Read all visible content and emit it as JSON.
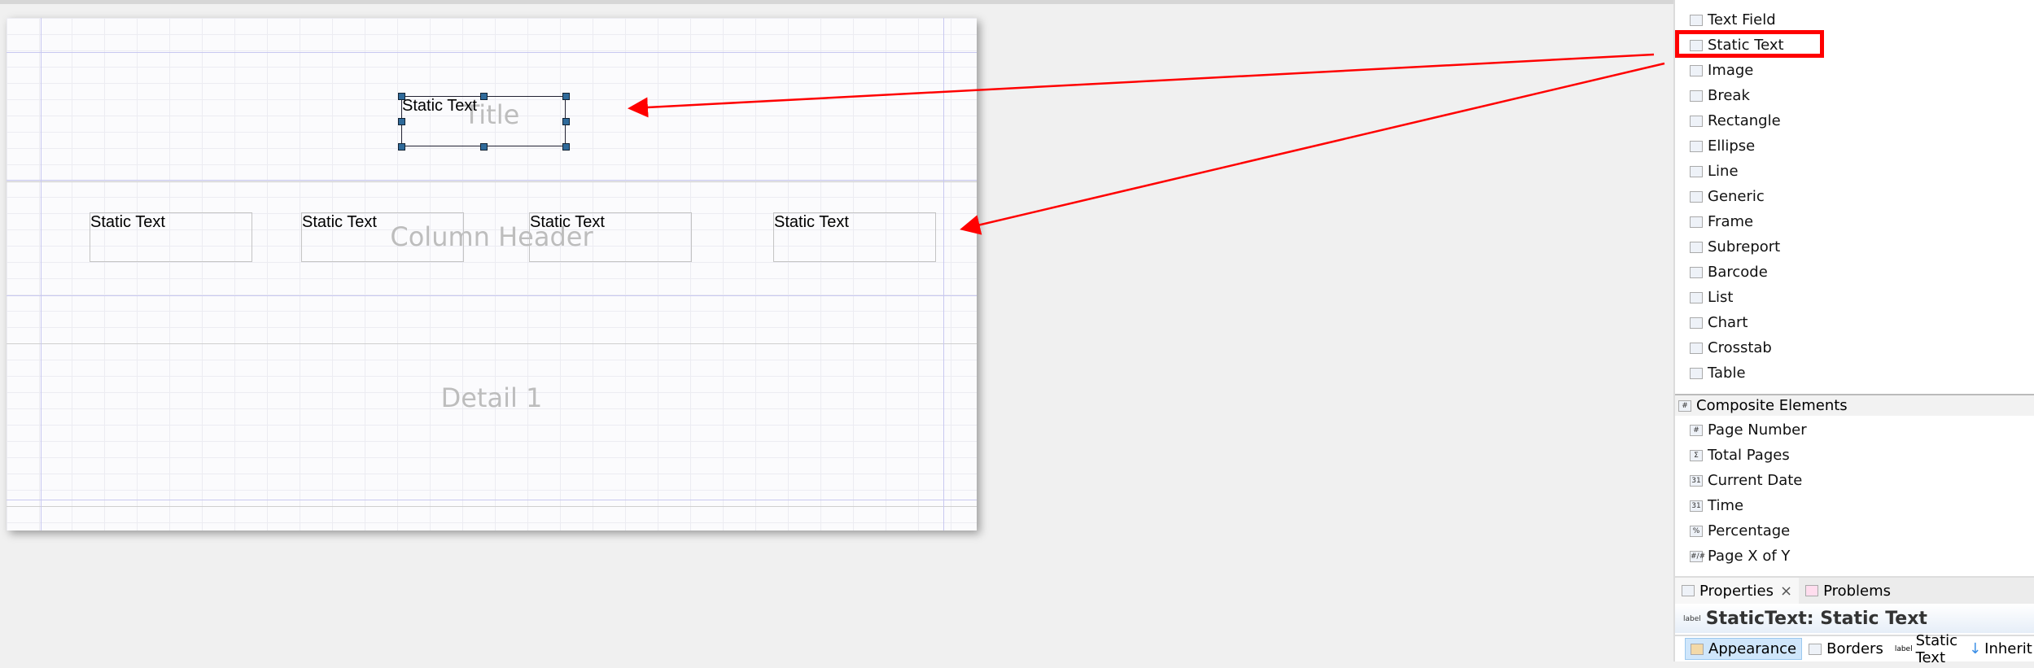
{
  "canvas": {
    "bands": {
      "title": "Title",
      "column_header": "Column Header",
      "detail": "Detail 1"
    },
    "title_element": "Static Text",
    "column_elements": [
      "Static Text",
      "Static Text",
      "Static Text",
      "Static Text"
    ]
  },
  "palette": {
    "basic_items": [
      {
        "label": "Text Field",
        "icon": "text-field-icon"
      },
      {
        "label": "Static Text",
        "icon": "label-icon",
        "highlighted": true
      },
      {
        "label": "Image",
        "icon": "image-icon"
      },
      {
        "label": "Break",
        "icon": "break-icon"
      },
      {
        "label": "Rectangle",
        "icon": "rectangle-icon"
      },
      {
        "label": "Ellipse",
        "icon": "ellipse-icon"
      },
      {
        "label": "Line",
        "icon": "line-icon"
      },
      {
        "label": "Generic",
        "icon": "generic-icon"
      },
      {
        "label": "Frame",
        "icon": "frame-icon"
      },
      {
        "label": "Subreport",
        "icon": "subreport-icon"
      },
      {
        "label": "Barcode",
        "icon": "barcode-icon"
      },
      {
        "label": "List",
        "icon": "list-icon"
      },
      {
        "label": "Chart",
        "icon": "chart-icon"
      },
      {
        "label": "Crosstab",
        "icon": "crosstab-icon"
      },
      {
        "label": "Table",
        "icon": "table-icon"
      }
    ],
    "composite_header": "Composite Elements",
    "composite_items": [
      {
        "label": "Page Number",
        "glyph": "#"
      },
      {
        "label": "Total Pages",
        "glyph": "Σ"
      },
      {
        "label": "Current Date",
        "glyph": "31"
      },
      {
        "label": "Time",
        "glyph": "31"
      },
      {
        "label": "Percentage",
        "glyph": "%"
      },
      {
        "label": "Page X of Y",
        "glyph": "#/#"
      }
    ]
  },
  "properties": {
    "tabs": [
      "Properties",
      "Problems"
    ],
    "close": "×",
    "title": "StaticText: Static Text",
    "subtabs": [
      "Appearance",
      "Borders",
      "Static Text",
      "Inherit"
    ]
  },
  "colors": {
    "highlight": "#ff0000",
    "arrow": "#ff0000"
  }
}
